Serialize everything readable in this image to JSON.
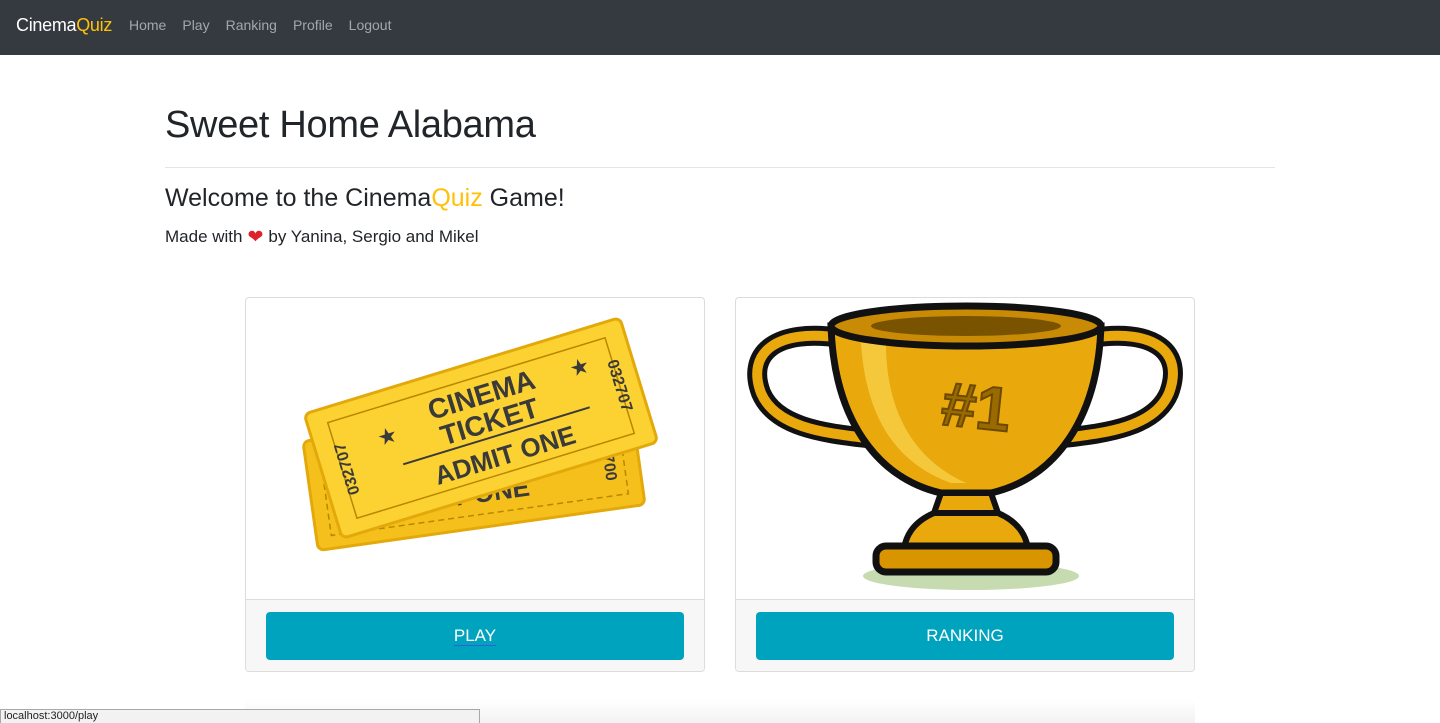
{
  "nav": {
    "brand_main": "Cinema",
    "brand_accent": "Quiz",
    "links": [
      "Home",
      "Play",
      "Ranking",
      "Profile",
      "Logout"
    ]
  },
  "main": {
    "title": "Sweet Home Alabama",
    "welcome_pre": "Welcome to the Cinema",
    "welcome_accent": "Quiz",
    "welcome_post": " Game!",
    "credits_pre": "Made with",
    "credits_post": "by Yanina, Sergio and Mikel"
  },
  "cards": [
    {
      "button_label": "PLAY",
      "ticket_text": {
        "line1": "CINEMA",
        "line2": "TICKET",
        "line3": "ADMIT ONE",
        "serial1": "032707",
        "serial2": "032700",
        "back_line": "ADMIT ONE"
      }
    },
    {
      "button_label": "RANKING",
      "trophy_text": "#1"
    }
  ],
  "status_bar": {
    "url": "localhost:3000/play"
  },
  "colors": {
    "navbar": "#343a40",
    "accent": "#ffc107",
    "button": "#00a3bd"
  },
  "icons": [
    "heart-icon",
    "cinema-ticket-image",
    "trophy-image"
  ]
}
